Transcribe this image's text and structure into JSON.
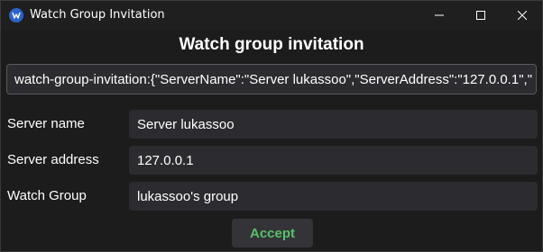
{
  "window": {
    "title": "Watch Group Invitation",
    "icon": "app-logo-icon"
  },
  "heading": "Watch group invitation",
  "invitation_string": "watch-group-invitation:{\"ServerName\":\"Server lukassoo\",\"ServerAddress\":\"127.0.0.1\",\"",
  "fields": [
    {
      "label": "Server name",
      "value": "Server lukassoo"
    },
    {
      "label": "Server address",
      "value": "127.0.0.1"
    },
    {
      "label": "Watch Group",
      "value": "lukassoo's group"
    }
  ],
  "accept_label": "Accept",
  "colors": {
    "background": "#1c1c1c",
    "input_bg": "#2c2c30",
    "accent_green": "#58c06a",
    "app_icon": "#2b63c8"
  }
}
